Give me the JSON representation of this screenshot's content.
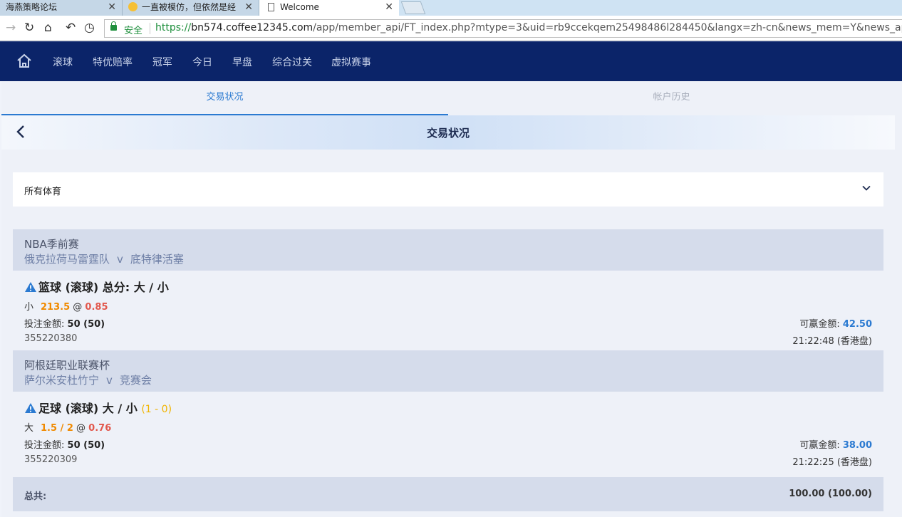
{
  "browser": {
    "tabs": [
      {
        "title": "海燕策略论坛"
      },
      {
        "title": "一直被模仿，但依然是经"
      },
      {
        "title": "Welcome"
      }
    ],
    "secure_label": "安全",
    "url_scheme": "https://",
    "url_host": "bn574.coffee12345.com",
    "url_path": "/app/member_api/FT_index.php?mtype=3&uid=rb9ccekqem25498486l284450&langx=zh-cn&news_mem=Y&news_api=Y&i"
  },
  "header": {
    "menu": [
      "滚球",
      "特优赔率",
      "冠军",
      "今日",
      "早盘",
      "综合过关",
      "虚拟赛事"
    ]
  },
  "tabs": {
    "active": "交易状况",
    "inactive": "帐户历史"
  },
  "subheader": {
    "title": "交易状况"
  },
  "filter": {
    "selected": "所有体育"
  },
  "bets": [
    {
      "league": "NBA季前赛",
      "home": "俄克拉荷马雷霆队",
      "vs": "v",
      "away": "底特律活塞",
      "market": "篮球 (滚球) 总分: 大 / 小",
      "score": "",
      "selection": "小",
      "handicap": "213.5",
      "at": "@",
      "odds": "0.85",
      "stake_label": "投注金额:",
      "stake": "50 (50)",
      "win_label": "可赢金额:",
      "win": "42.50",
      "ticket": "355220380",
      "time": "21:22:48 (香港盘)"
    },
    {
      "league": "阿根廷职业联赛杯",
      "home": "萨尔米安杜竹宁",
      "vs": "v",
      "away": "竞赛会",
      "market": "足球 (滚球) 大 / 小",
      "score": "(1 - 0)",
      "selection": "大",
      "handicap": "1.5 / 2",
      "at": "@",
      "odds": "0.76",
      "stake_label": "投注金额:",
      "stake": "50 (50)",
      "win_label": "可赢金额:",
      "win": "38.00",
      "ticket": "355220309",
      "time": "21:22:25 (香港盘)"
    }
  ],
  "total": {
    "label": "总共:",
    "value": "100.00 (100.00)"
  }
}
